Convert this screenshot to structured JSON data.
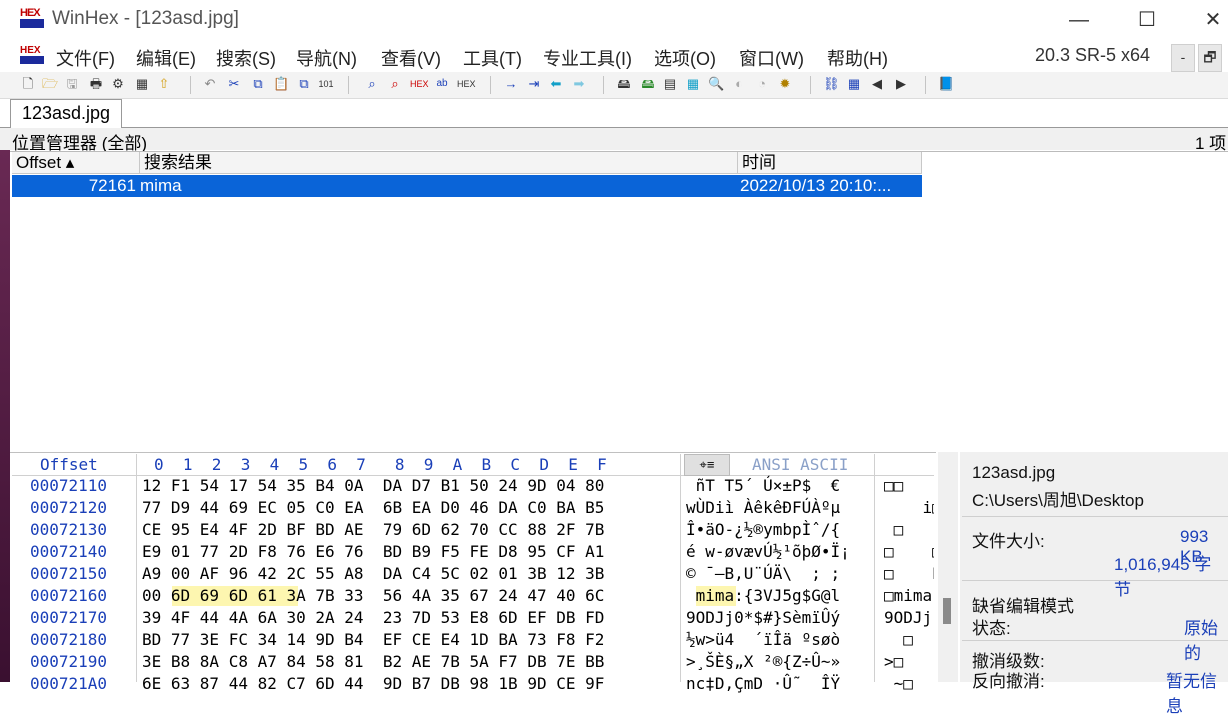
{
  "window": {
    "title": "WinHex - [123asd.jpg]",
    "logo_text": "HEX",
    "minimize": "—",
    "maximize": "☐",
    "close": "✕"
  },
  "menu": {
    "items": [
      "文件(F)",
      "编辑(E)",
      "搜索(S)",
      "导航(N)",
      "查看(V)",
      "工具(T)",
      "专业工具(I)",
      "选项(O)",
      "窗口(W)",
      "帮助(H)"
    ],
    "version": "20.3 SR-5 x64",
    "mini_minimize": "-",
    "mini_restore": "🗗"
  },
  "tab": {
    "label": "123asd.jpg"
  },
  "position_manager": {
    "title": "位置管理器 (全部)",
    "count": "1 项",
    "columns": [
      "Offset ▴",
      "搜索结果",
      "时间"
    ],
    "rows": [
      {
        "offset": "72161",
        "result": "mima",
        "time": "2022/10/13  20:10:..."
      }
    ]
  },
  "hex": {
    "header_offset": "Offset",
    "header_cols": "0  1  2  3  4  5  6  7   8  9  A  B  C  D  E  F",
    "header_charset": "ANSI ASCII",
    "lines": [
      {
        "off": "00072110",
        "hex": "12 F1 54 17 54 35 B4 0A  DA D7 B1 50 24 9D 04 80",
        "ansi": " ñT T5´ Ú×±P$  €",
        "ascii": "□□"
      },
      {
        "off": "00072120",
        "hex": "77 D9 44 69 EC 05 C0 EA  6B EA D0 46 DA C0 BA B5",
        "ansi": "wÙDiì ÀêkêÐFÚÀºµ",
        "ascii": "    i□"
      },
      {
        "off": "00072130",
        "hex": "CE 95 E4 4F 2D BF BD AE  79 6D 62 70 CC 88 2F 7B",
        "ansi": "Î•äO-¿½®ymbpÌˆ/{",
        "ascii": " □"
      },
      {
        "off": "00072140",
        "hex": "E9 01 77 2D F8 76 E6 76  BD B9 F5 FE D8 95 CF A1",
        "ansi": "é w-øvævÚ½¹õþØ•Ï¡",
        "ascii": "□    □"
      },
      {
        "off": "00072150",
        "hex": "A9 00 AF 96 42 2C 55 A8  DA C4 5C 02 01 3B 12 3B",
        "ansi": "© ¯–B,U¨ÚÄ\\  ; ;",
        "ascii": "□    E"
      },
      {
        "off": "00072160",
        "hex": "00 6D 69 6D 61 3A 7B 33  56 4A 35 67 24 47 40 6C",
        "ansi": " mima:{3VJ5g$G@l",
        "ascii": "□mima"
      },
      {
        "off": "00072170",
        "hex": "39 4F 44 4A 6A 30 2A 24  23 7D 53 E8 6D EF DB FD",
        "ansi": "9ODJj0*$#}SèmïÛý",
        "ascii": "9ODJj"
      },
      {
        "off": "00072180",
        "hex": "BD 77 3E FC 34 14 9D B4  EF CE E4 1D BA 73 F8 F2",
        "ansi": "½w>ü4  ´ïÎä ºsøò",
        "ascii": "  □"
      },
      {
        "off": "00072190",
        "hex": "3E B8 8A C8 A7 84 58 81  B2 AE 7B 5A F7 DB 7E BB",
        "ansi": ">¸ŠÈ§„X ²®{Z÷Û~»",
        "ascii": ">□"
      },
      {
        "off": "000721A0",
        "hex": "6E 63 87 44 82 C7 6D 44  9D B7 DB 98 1B 9D CE 9F",
        "ansi": "nc‡D‚ÇmD ·Û˜  ÎŸ",
        "ascii": " ~□"
      }
    ]
  },
  "side_panel": {
    "filename": "123asd.jpg",
    "path": "C:\\Users\\周旭\\Desktop",
    "size_label": "文件大小:",
    "size_kb": "993 KB",
    "size_bytes": "1,016,945 字节",
    "mode_label": "缺省编辑模式",
    "state_label": "状态:",
    "state_value": "原始的",
    "undo_label": "撤消级数:",
    "redo_label": "反向撤消:",
    "redo_value": "暂无信息"
  }
}
